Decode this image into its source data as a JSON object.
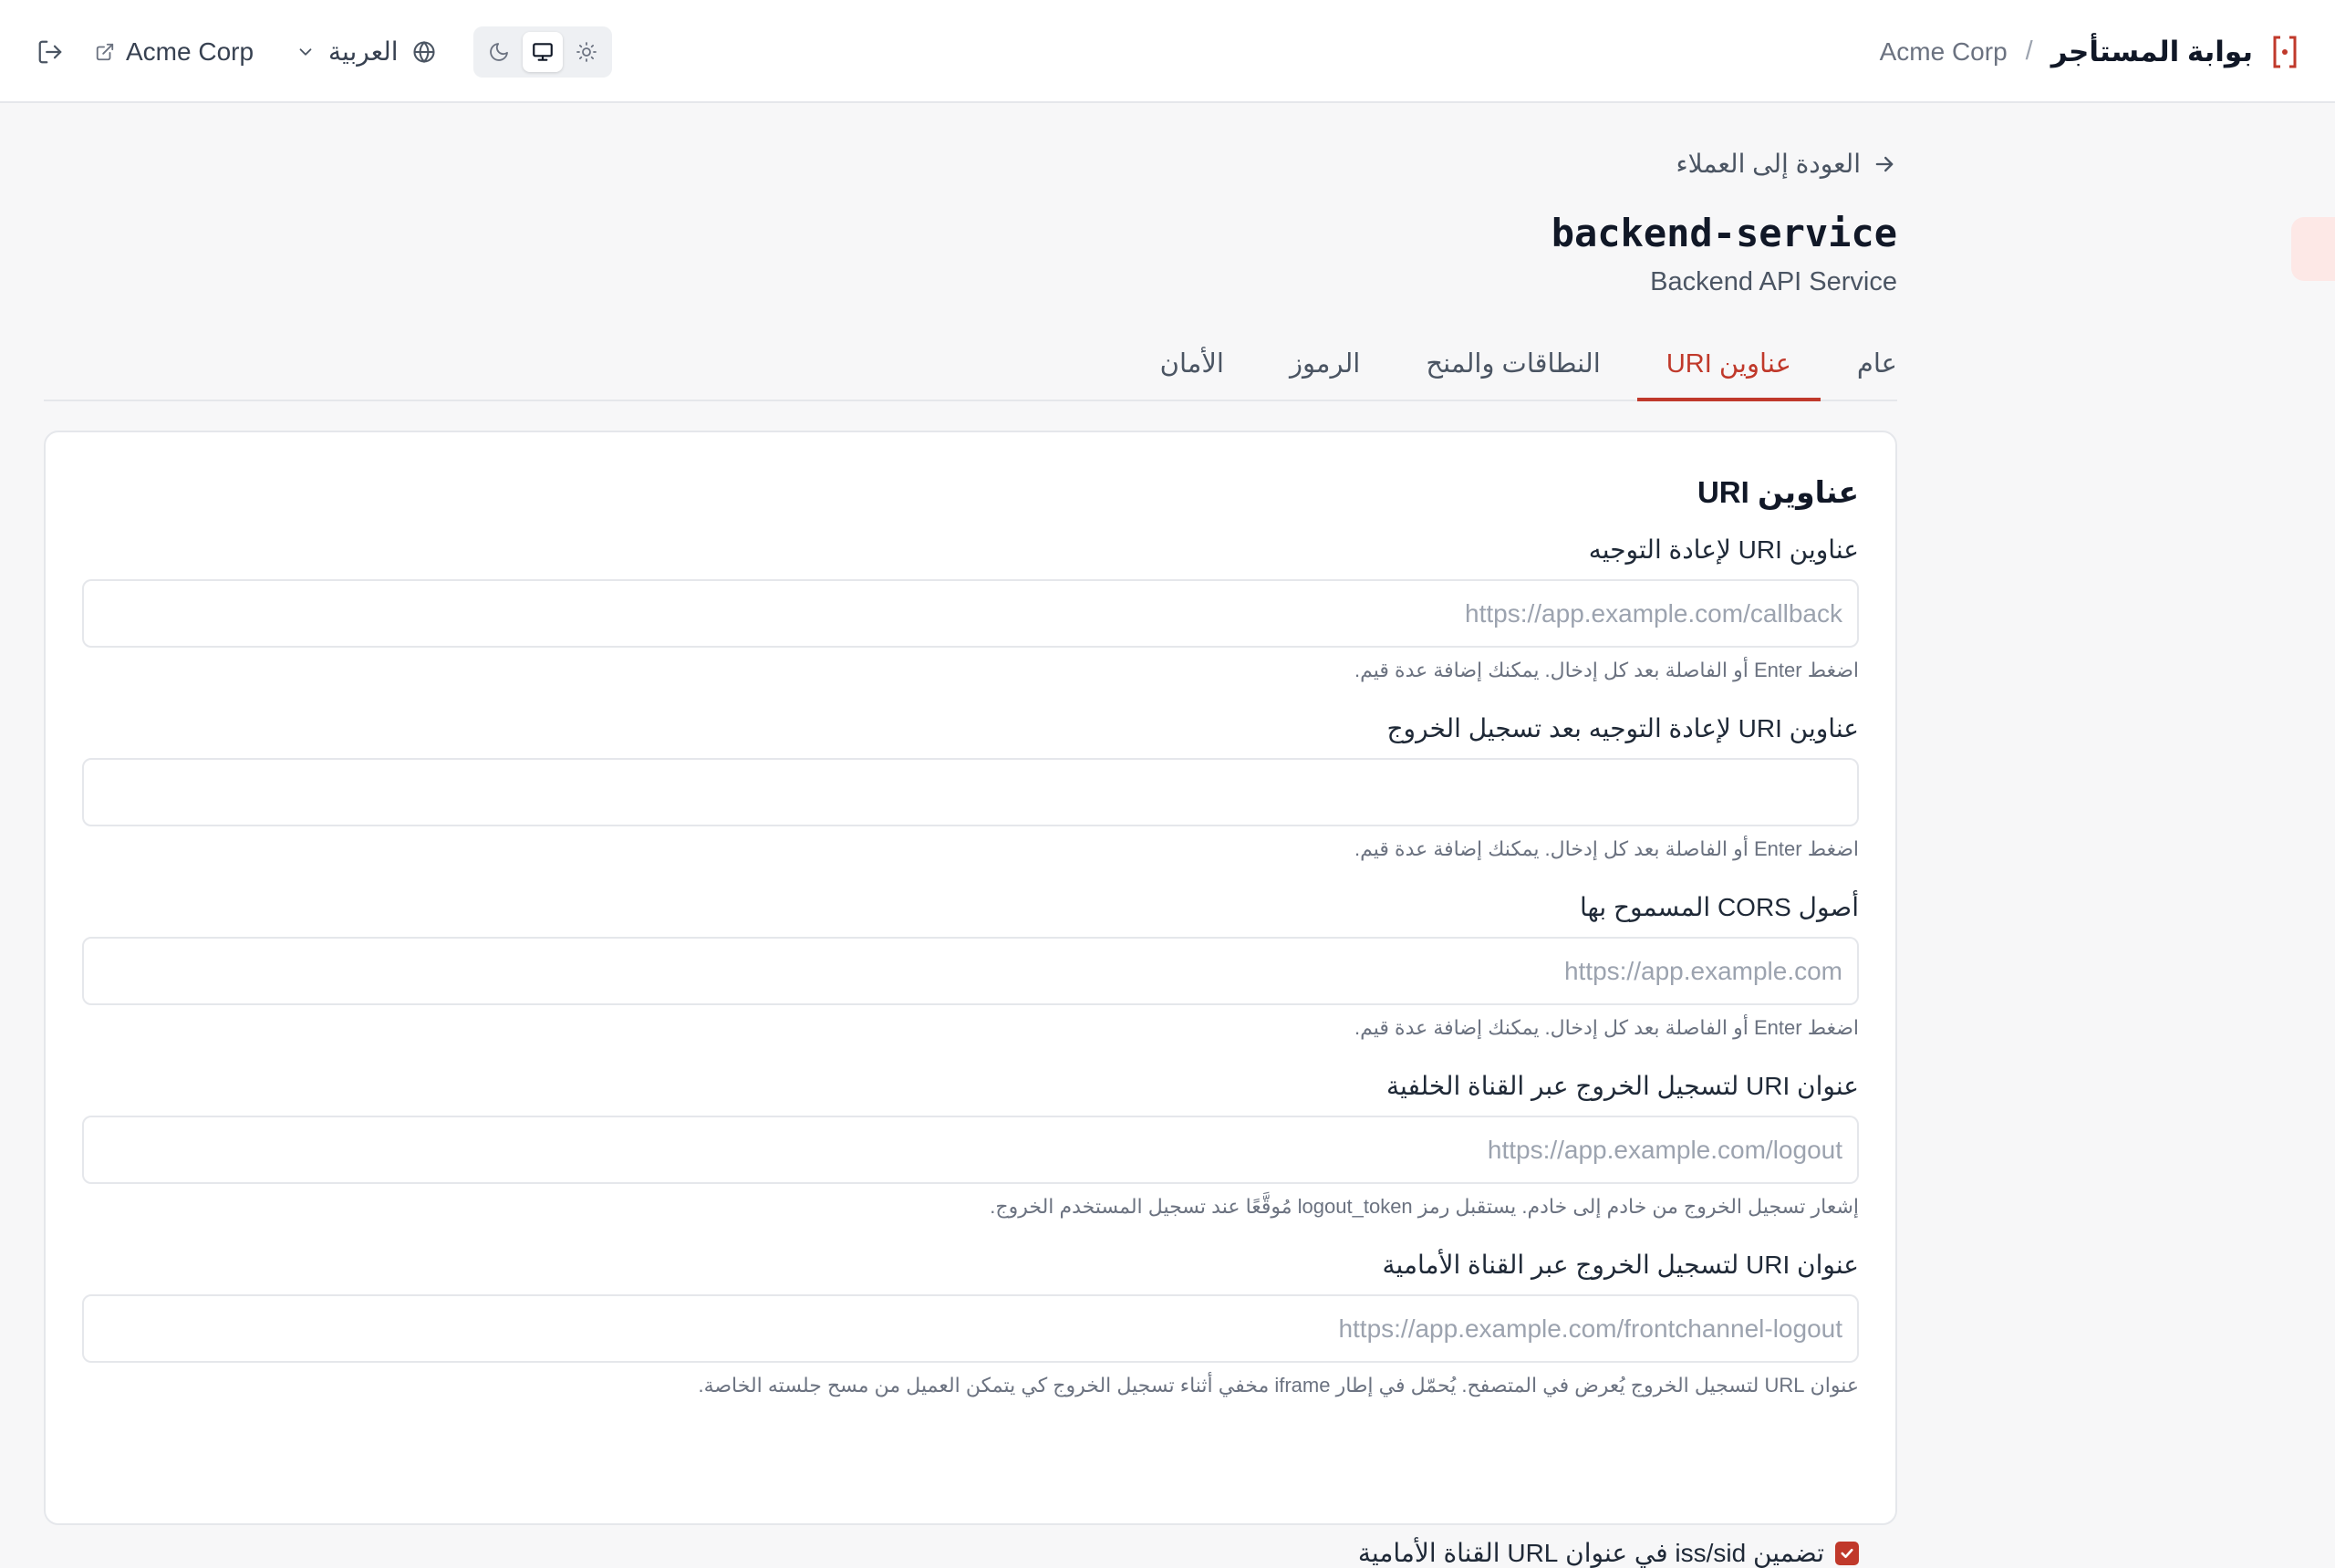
{
  "header": {
    "app_title": "بوابة المستأجر",
    "breadcrumb_separator": "/",
    "tenant": "Acme Corp",
    "tenant_link": "Acme Corp",
    "language": "العربية",
    "theme_options": [
      "moon-icon",
      "monitor-icon",
      "sun-icon"
    ],
    "theme_selected": "monitor-icon"
  },
  "page": {
    "back_link": "العودة إلى العملاء",
    "client_id": "backend-service",
    "client_name": "Backend API Service"
  },
  "tabs": [
    {
      "label": "عام",
      "active": false
    },
    {
      "label": "عناوين URI",
      "active": true
    },
    {
      "label": "النطاقات والمنح",
      "active": false
    },
    {
      "label": "الرموز",
      "active": false
    },
    {
      "label": "الأمان",
      "active": false
    }
  ],
  "card": {
    "title": "عناوين URI",
    "fields": [
      {
        "label": "عناوين URI لإعادة التوجيه",
        "value": "",
        "placeholder": "https://app.example.com/callback",
        "help": "اضغط Enter أو الفاصلة بعد كل إدخال. يمكنك إضافة عدة قيم."
      },
      {
        "label": "عناوين URI لإعادة التوجيه بعد تسجيل الخروج",
        "value": "",
        "placeholder": "",
        "help": "اضغط Enter أو الفاصلة بعد كل إدخال. يمكنك إضافة عدة قيم."
      },
      {
        "label": "أصول CORS المسموح بها",
        "value": "",
        "placeholder": "https://app.example.com",
        "help": "اضغط Enter أو الفاصلة بعد كل إدخال. يمكنك إضافة عدة قيم."
      },
      {
        "label": "عنوان URI لتسجيل الخروج عبر القناة الخلفية",
        "value": "",
        "placeholder": "https://app.example.com/logout",
        "help": "إشعار تسجيل الخروج من خادم إلى خادم. يستقبل رمز logout_token مُوقَّعًا عند تسجيل المستخدم الخروج."
      },
      {
        "label": "عنوان URI لتسجيل الخروج عبر القناة الأمامية",
        "value": "",
        "placeholder": "https://app.example.com/frontchannel-logout",
        "help": "عنوان URL لتسجيل الخروج يُعرض في المتصفح. يُحمّل في إطار iframe مخفي أثناء تسجيل الخروج كي يتمكن العميل من مسح جلسته الخاصة."
      }
    ],
    "checkbox": {
      "label": "تضمين iss/sid في عنوان URL القناة الأمامية",
      "checked": true
    }
  },
  "colors": {
    "accent": "#c0392b",
    "side_tab": "#fde8e6",
    "border": "#e5e7eb"
  }
}
